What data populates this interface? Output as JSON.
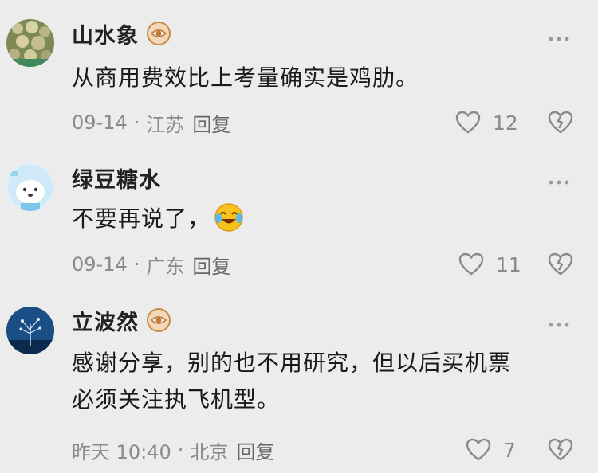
{
  "comments": [
    {
      "username": "山水象",
      "badge_icon": "eye-badge-icon",
      "text": "从商用费效比上考量确实是鸡肋。",
      "date": "09-14",
      "location": "江苏",
      "reply_label": "回复",
      "likes": "12"
    },
    {
      "username": "绿豆糖水",
      "text": "不要再说了，",
      "emoji_icon": "crying-laughing-emoji",
      "date": "09-14",
      "location": "广东",
      "reply_label": "回复",
      "likes": "11"
    },
    {
      "username": "立波然",
      "badge_icon": "eye-badge-icon",
      "text_line1": "感谢分享，别的也不用研究，但以后买机票",
      "text_line2": "必须关注执飞机型。",
      "date": "昨天 10:40",
      "location": "北京",
      "reply_label": "回复",
      "likes": "7"
    }
  ],
  "separator": "·",
  "colors": {
    "background": "#ececec",
    "badge": "#e9a35b",
    "meta_text": "#8a8a8a"
  }
}
